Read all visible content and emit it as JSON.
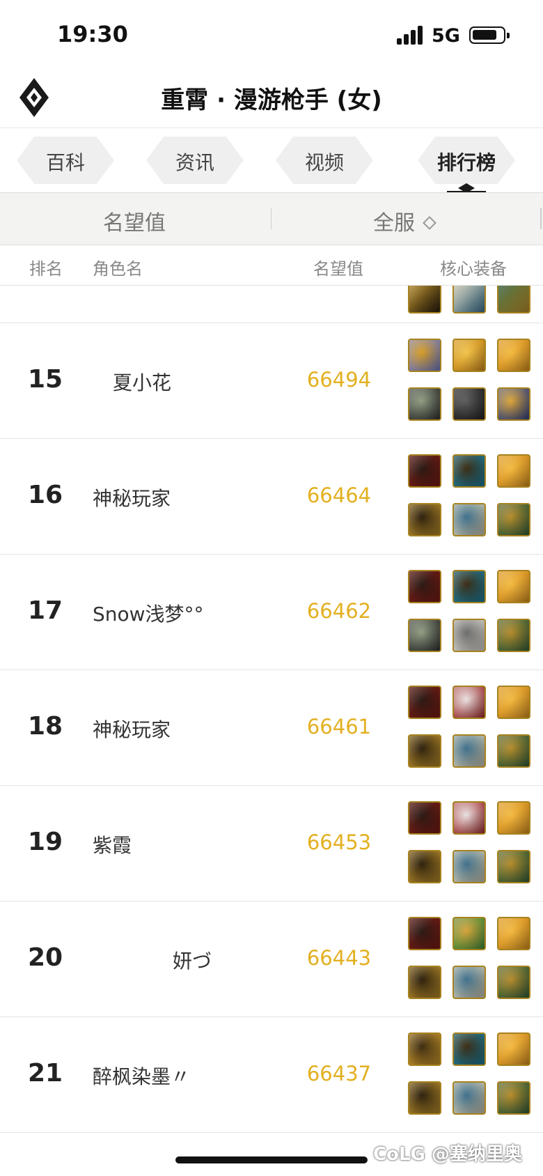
{
  "status_bar": {
    "time": "19:30",
    "network": "5G"
  },
  "header": {
    "title": "重霄 · 漫游枪手 (女)",
    "logo_icon": "diamond-logo-icon"
  },
  "tabs": [
    {
      "label": "百科",
      "active": false
    },
    {
      "label": "资讯",
      "active": false
    },
    {
      "label": "视频",
      "active": false
    },
    {
      "label": "排行榜",
      "active": true
    }
  ],
  "filters": {
    "left_label": "名望值",
    "right_label": "全服",
    "right_icon": "diamond-sort-icon"
  },
  "columns": {
    "rank": "排名",
    "name": "角色名",
    "score": "名望值",
    "equipment": "核心装备"
  },
  "rows": [
    {
      "rank": "15",
      "name": "夏小花",
      "score": "66494",
      "equipment": [
        [
          "#6a78c8",
          "#d49a22"
        ],
        [
          "#c7861a",
          "#f0c24a"
        ],
        [
          "#d08a1d",
          "#f2b941"
        ],
        [
          "#2d2d2d",
          "#8e9a80"
        ],
        [
          "#1e1e1e",
          "#5a5a5a"
        ],
        [
          "#2a3e86",
          "#d9a336"
        ]
      ]
    },
    {
      "rank": "16",
      "name": "神秘玩家",
      "score": "66464",
      "equipment": [
        [
          "#7a1a14",
          "#2a1a14"
        ],
        [
          "#1b7d9c",
          "#3c2b12"
        ],
        [
          "#d08a1d",
          "#f2b941"
        ],
        [
          "#b58a2a",
          "#2b1f0d"
        ],
        [
          "#cfc8b0",
          "#3d6e8a"
        ],
        [
          "#2c5a3a",
          "#b38a2b"
        ]
      ]
    },
    {
      "rank": "17",
      "name": "Snow浅梦°°",
      "score": "66462",
      "equipment": [
        [
          "#7a1a14",
          "#2a1a14"
        ],
        [
          "#1b7d9c",
          "#3c2b12"
        ],
        [
          "#d08a1d",
          "#f2b941"
        ],
        [
          "#2d2d2d",
          "#8e9a80"
        ],
        [
          "#d9d6cf",
          "#6a6a6a"
        ],
        [
          "#2c5a3a",
          "#b38a2b"
        ]
      ]
    },
    {
      "rank": "18",
      "name": "神秘玩家",
      "score": "66461",
      "equipment": [
        [
          "#7a1a14",
          "#2a1a14"
        ],
        [
          "#9c2626",
          "#e8e0e0"
        ],
        [
          "#d08a1d",
          "#f2b941"
        ],
        [
          "#b58a2a",
          "#2b1f0d"
        ],
        [
          "#cfc8b0",
          "#3d6e8a"
        ],
        [
          "#2c5a3a",
          "#b38a2b"
        ]
      ]
    },
    {
      "rank": "19",
      "name": "紫霞",
      "score": "66453",
      "equipment": [
        [
          "#7a1a14",
          "#2a1a14"
        ],
        [
          "#9c2626",
          "#e8e0e0"
        ],
        [
          "#d08a1d",
          "#f2b941"
        ],
        [
          "#b58a2a",
          "#2b1f0d"
        ],
        [
          "#cfc8b0",
          "#3d6e8a"
        ],
        [
          "#2c5a3a",
          "#b38a2b"
        ]
      ]
    },
    {
      "rank": "20",
      "name": "妍づ",
      "score": "66443",
      "equipment": [
        [
          "#7a1a14",
          "#2a1a14"
        ],
        [
          "#3a8a3a",
          "#d4a13a"
        ],
        [
          "#d08a1d",
          "#f2b941"
        ],
        [
          "#b58a2a",
          "#2b1f0d"
        ],
        [
          "#cfc8b0",
          "#3d6e8a"
        ],
        [
          "#2c5a3a",
          "#b38a2b"
        ]
      ]
    },
    {
      "rank": "21",
      "name": "醉枫染墨〃",
      "score": "66437",
      "equipment": [
        [
          "#c9962c",
          "#3a2a10"
        ],
        [
          "#1b7d9c",
          "#3c2b12"
        ],
        [
          "#d08a1d",
          "#f2b941"
        ],
        [
          "#b58a2a",
          "#2b1f0d"
        ],
        [
          "#cfc8b0",
          "#3d6e8a"
        ],
        [
          "#2c5a3a",
          "#b38a2b"
        ]
      ]
    }
  ],
  "watermark": "CoLG @塞纳里奥"
}
